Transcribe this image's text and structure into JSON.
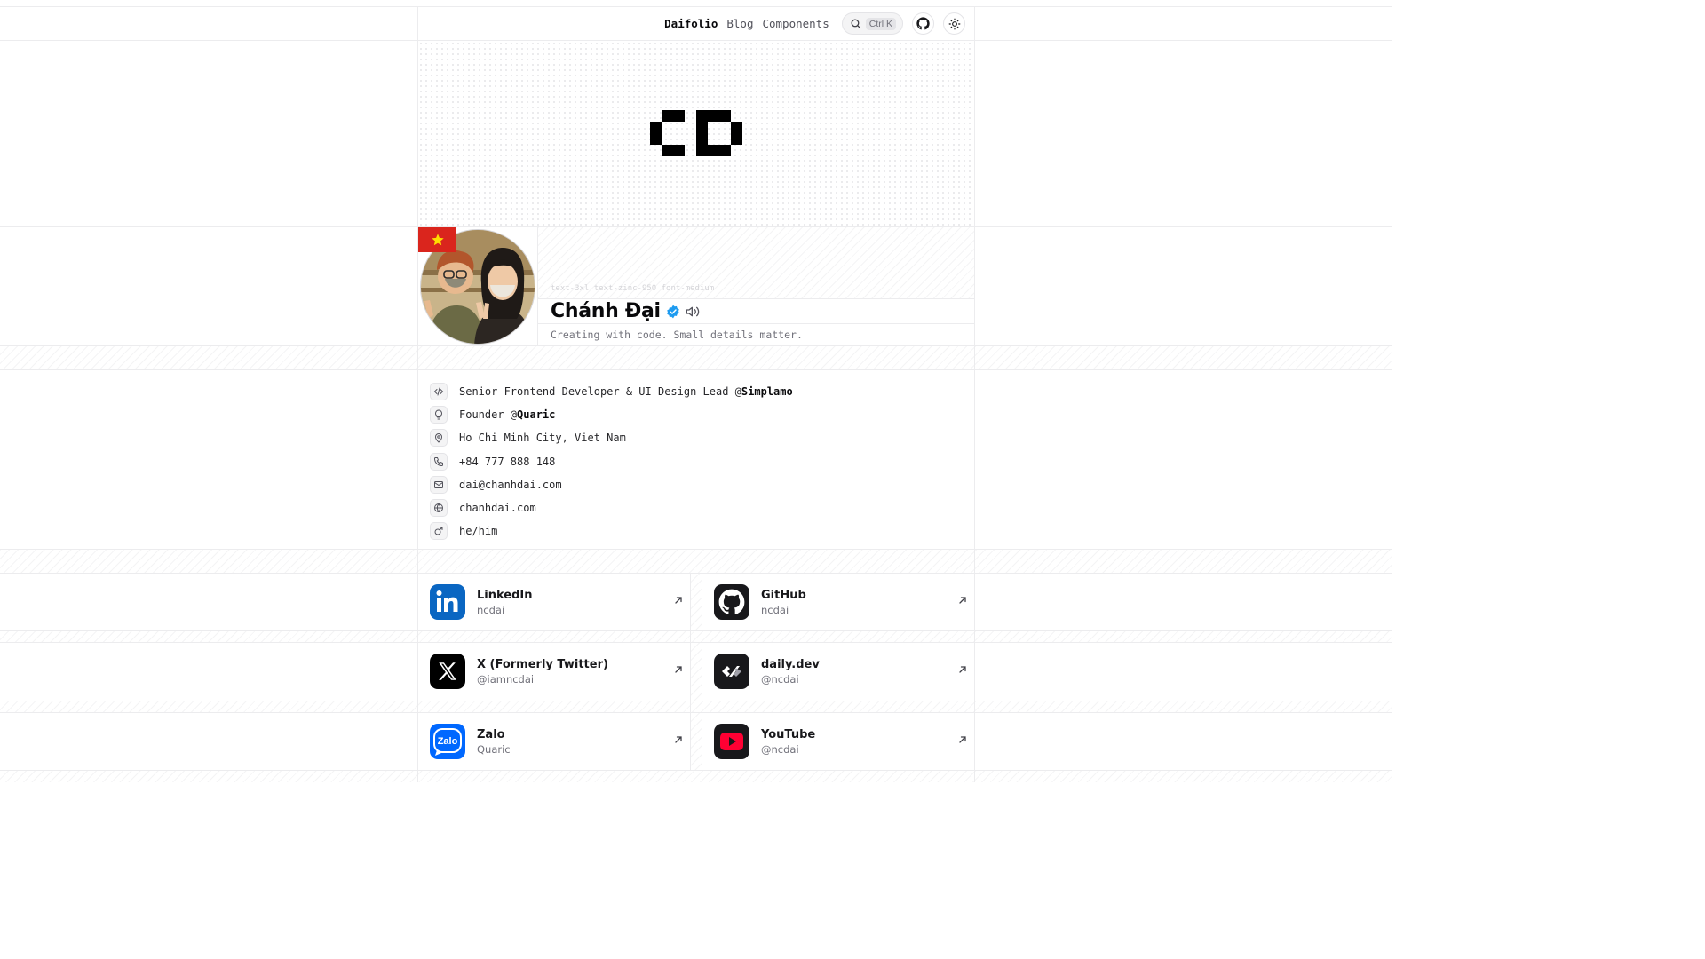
{
  "nav": {
    "links": [
      "Daifolio",
      "Blog",
      "Components"
    ],
    "search_shortcut": "Ctrl K"
  },
  "profile": {
    "class_hint": "text-3xl text-zinc-950 font-medium",
    "name": "Chánh Đại",
    "tagline": "Creating with code. Small details matter."
  },
  "info": [
    {
      "icon": "code-icon",
      "text": "Senior Frontend Developer & UI Design Lead @",
      "strong": "Simplamo"
    },
    {
      "icon": "lightbulb-icon",
      "text": "Founder @",
      "strong": "Quaric"
    },
    {
      "icon": "map-pin-icon",
      "text": "Ho Chi Minh City, Viet Nam",
      "strong": ""
    },
    {
      "icon": "phone-icon",
      "text": "+84 777 888 148",
      "strong": ""
    },
    {
      "icon": "mail-icon",
      "text": "dai@chanhdai.com",
      "strong": ""
    },
    {
      "icon": "globe-icon",
      "text": "chanhdai.com",
      "strong": ""
    },
    {
      "icon": "mars-icon",
      "text": "he/him",
      "strong": ""
    }
  ],
  "social": [
    {
      "title": "LinkedIn",
      "handle": "ncdai",
      "icon": "linkedin-icon",
      "color": "#0a66c2"
    },
    {
      "title": "GitHub",
      "handle": "ncdai",
      "icon": "github-icon",
      "color": "#18181b"
    },
    {
      "title": "X (Formerly Twitter)",
      "handle": "@iamncdai",
      "icon": "x-icon",
      "color": "#000000"
    },
    {
      "title": "daily.dev",
      "handle": "@ncdai",
      "icon": "dailydev-icon",
      "color": "#18181b"
    },
    {
      "title": "Zalo",
      "handle": "Quaric",
      "icon": "zalo-icon",
      "color": "#0068ff"
    },
    {
      "title": "YouTube",
      "handle": "@ncdai",
      "icon": "youtube-icon",
      "color": "#18181b"
    }
  ]
}
